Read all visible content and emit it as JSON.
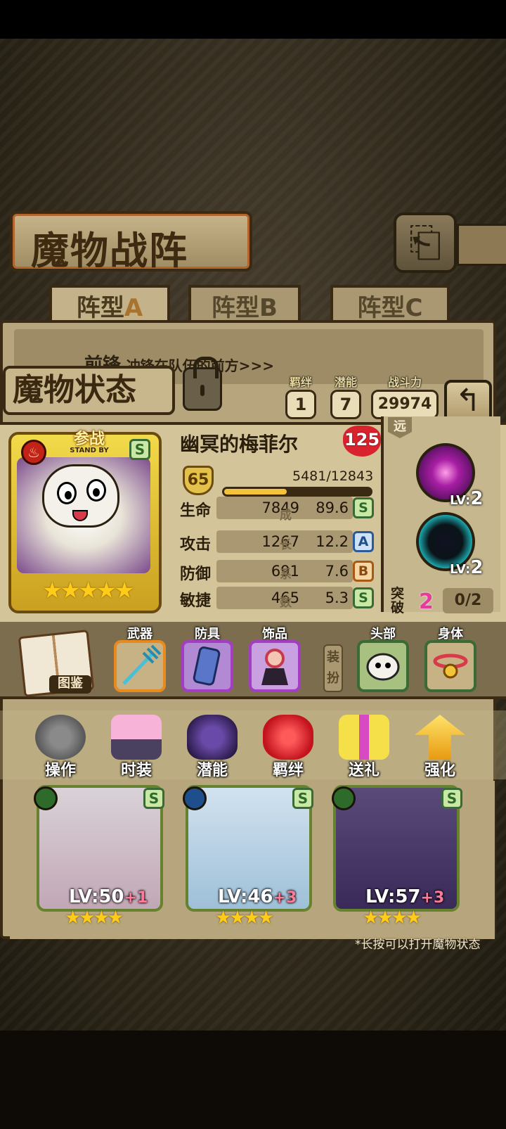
{
  "screen": {
    "title": "魔物战阵",
    "back_icon": "back-arrow-icon"
  },
  "tabs": [
    {
      "label": "阵型",
      "letter": "A",
      "active": true
    },
    {
      "label": "阵型",
      "letter": "B",
      "active": false
    },
    {
      "label": "阵型",
      "letter": "C",
      "active": false
    }
  ],
  "front_row": {
    "title": "前锋",
    "desc": "冲锋在队伍的前方>>>"
  },
  "status": {
    "title": "魔物状态",
    "bond_label": "羁绊",
    "bond_value": "1",
    "potential_label": "潜能",
    "potential_value": "7",
    "power_label": "战斗力",
    "power_value": "29974"
  },
  "monster": {
    "name": "幽冥的梅菲尔",
    "affinity": "125",
    "stand_by_cn": "参战",
    "stand_by_en": "STAND BY",
    "grade": "S",
    "element_icon": "fire-element-icon",
    "stars": "★★★★★",
    "level": "65",
    "exp_text": "5481/12843",
    "exp_ratio": 0.4268,
    "growth_label_chars": [
      "成",
      "长",
      "系",
      "数"
    ],
    "stats": [
      {
        "name": "生命",
        "value": "7849",
        "growth": "89.6",
        "grade": "S"
      },
      {
        "name": "攻击",
        "value": "1267",
        "growth": "12.2",
        "grade": "A"
      },
      {
        "name": "防御",
        "value": "691",
        "growth": "7.6",
        "grade": "B"
      },
      {
        "name": "敏捷",
        "value": "465",
        "growth": "5.3",
        "grade": "S"
      }
    ]
  },
  "skills": {
    "range": "远",
    "items": [
      {
        "icon": "void-cross-skill-icon",
        "lv_label": "LV:",
        "lv": "2"
      },
      {
        "icon": "cyan-vortex-skill-icon",
        "lv_label": "LV:",
        "lv": "2"
      }
    ],
    "break_label": "突破",
    "break_value": "2",
    "break_progress": "0/2"
  },
  "equipment": {
    "codex_label": "图鉴",
    "dress_label": "装扮",
    "slots": [
      {
        "label": "武器",
        "icon": "trident-weapon-icon"
      },
      {
        "label": "防具",
        "icon": "gauntlet-armor-icon"
      },
      {
        "label": "饰品",
        "icon": "doll-accessory-icon"
      },
      {
        "label": "头部",
        "icon": "dog-head-icon"
      },
      {
        "label": "身体",
        "icon": "bell-collar-icon"
      }
    ]
  },
  "menu": [
    {
      "label": "操作",
      "icon": "gear-icon"
    },
    {
      "label": "时装",
      "icon": "outfit-icon"
    },
    {
      "label": "潜能",
      "icon": "demon-silhouette-icon"
    },
    {
      "label": "羁绊",
      "icon": "hearts-icon"
    },
    {
      "label": "送礼",
      "icon": "gift-icon"
    },
    {
      "label": "强化",
      "icon": "upgrade-arrows-icon"
    }
  ],
  "team": [
    {
      "lv_label": "LV:",
      "lv": "50",
      "plus": "+1",
      "grade": "S",
      "element": "leaf-element-icon",
      "stars": "★★★★"
    },
    {
      "lv_label": "LV:",
      "lv": "46",
      "plus": "+3",
      "grade": "S",
      "element": "water-element-icon",
      "stars": "★★★★"
    },
    {
      "lv_label": "LV:",
      "lv": "57",
      "plus": "+3",
      "grade": "S",
      "element": "leaf-element-icon",
      "stars": "★★★★"
    }
  ],
  "hint": "*长按可以打开魔物状态"
}
